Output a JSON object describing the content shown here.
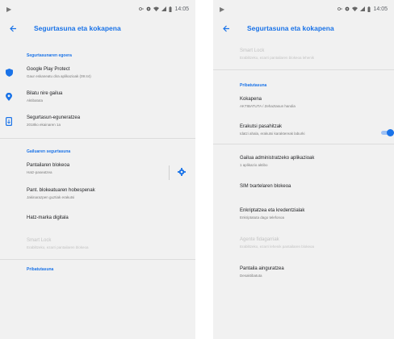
{
  "colors": {
    "accent": "#1a73e8",
    "screen_bg": "#f1f1f1",
    "disabled_text": "#c2c2c2"
  },
  "statusbar": {
    "left_icon": "play-store-icon",
    "time": "14:05"
  },
  "left": {
    "title": "Segurtasuna eta kokapena",
    "section1_header": "Segurtasunaren egoera",
    "items1": [
      {
        "icon": "shield-icon",
        "primary": "Google Play Protect",
        "secondary": "Gaur eskaneatu dira aplikazioak (09:44)"
      },
      {
        "icon": "location-pin-icon",
        "primary": "Bilatu nire gailua",
        "secondary": "Aktibatuta"
      },
      {
        "icon": "phone-update-icon",
        "primary": "Segurtasun-eguneratzea",
        "secondary": "2018ko ekainaren 1a"
      }
    ],
    "section2_header": "Gailuaren segurtasuna",
    "screen_lock": {
      "primary": "Pantailaren blokeoa",
      "secondary": "Hatz-paseatzea",
      "gear_icon": "gear-icon"
    },
    "items2": [
      {
        "primary": "Pant. blokeatuaren hobespenak",
        "secondary": "Jakinarazpen guztiak erakutsi",
        "disabled": false
      },
      {
        "primary": "Hatz-marka digitala",
        "secondary": "",
        "disabled": false
      },
      {
        "primary": "Smart Lock",
        "secondary": "Erabiltzeko, ezarri pantailaren blokeoa",
        "disabled": true
      }
    ],
    "section3_header": "Pribatutasuna"
  },
  "right": {
    "title": "Segurtasuna eta kokapena",
    "top_disabled": {
      "primary": "Smart Lock",
      "secondary": "Erabiltzeko, ezarri pantailaren blokeoa lehenik"
    },
    "section_header": "Pribatutasuna",
    "items": [
      {
        "primary": "Kokapena",
        "secondary": "AKTIBATUTA / Zehaztasun handia",
        "disabled": false,
        "toggle": false
      },
      {
        "primary": "Erakutsi pasahitzak",
        "secondary": "Idatzi ahala, erakutsi karaktereak laburki",
        "disabled": false,
        "toggle": true,
        "toggle_on": true
      },
      {
        "primary": "Gailua administratzeko aplikazioak",
        "secondary": "1 aplikazio aktibo",
        "disabled": false,
        "toggle": false
      },
      {
        "primary": "SIM txartelaren blokeoa",
        "secondary": "",
        "disabled": false,
        "toggle": false
      },
      {
        "primary": "Enkriptatzea eta kredentzialak",
        "secondary": "Enkriptatuta dago telefonoa",
        "disabled": false,
        "toggle": false
      },
      {
        "primary": "Agente fidagarriak",
        "secondary": "Erabiltzeko, ezarri lehenik pantailaren blokeoa",
        "disabled": true,
        "toggle": false
      },
      {
        "primary": "Pantaila ainguratzea",
        "secondary": "Desaktibatuta",
        "disabled": false,
        "toggle": false
      }
    ]
  }
}
